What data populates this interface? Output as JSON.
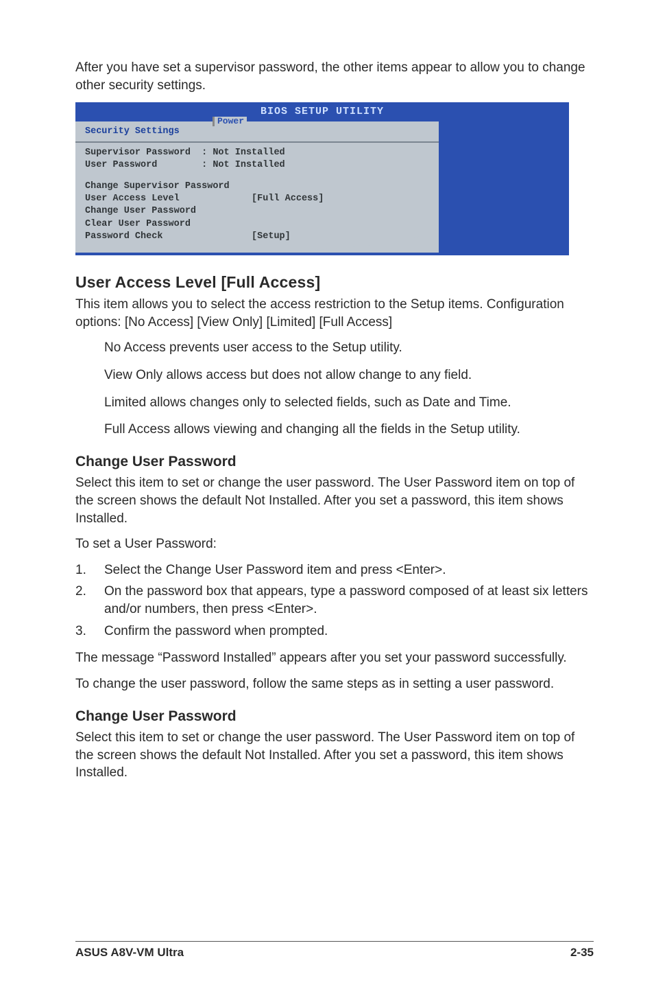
{
  "intro": "After you have set a supervisor password, the other items appear to allow you to change other security settings.",
  "bios": {
    "title": "BIOS SETUP UTILITY",
    "tab": "Power",
    "section_title": "Security Settings",
    "lines": {
      "l1": "Supervisor Password  : Not Installed",
      "l2": "User Password        : Not Installed",
      "l3": "Change Supervisor Password",
      "l4": "User Access Level             [Full Access]",
      "l5": "Change User Password",
      "l6": "Clear User Password",
      "l7": "Password Check                [Setup]"
    }
  },
  "ual": {
    "heading": "User Access Level [Full Access]",
    "p1": "This item allows you to select the access restriction to the Setup items. Configuration options: [No Access] [View Only] [Limited] [Full Access]",
    "b1": "No Access prevents user access to the Setup utility.",
    "b2": "View Only allows access but does not allow change to any field.",
    "b3": "Limited allows changes only to selected fields, such as Date and Time.",
    "b4": "Full Access allows viewing and changing all the fields in the Setup utility."
  },
  "cup1": {
    "heading": "Change User Password",
    "p1": "Select this item to set or change the user password. The User Password item on top of the screen shows the default Not Installed. After you set a password, this item shows Installed.",
    "p2": "To set a User Password:",
    "s1": "Select the Change User Password item and press <Enter>.",
    "s2": "On the password box that appears, type a password composed of at least six letters and/or numbers, then press <Enter>.",
    "s3": "Confirm the password when prompted.",
    "p3": "The message “Password Installed” appears after you set your password successfully.",
    "p4": "To change the user password, follow the same steps as in setting a user password."
  },
  "cup2": {
    "heading": "Change User Password",
    "p1": "Select this item to set or change the user password. The User Password item on top of the screen shows the default Not Installed. After you set a password, this item shows Installed."
  },
  "steps_num": {
    "n1": "1.",
    "n2": "2.",
    "n3": "3."
  },
  "footer": {
    "left": "ASUS A8V-VM Ultra",
    "right": "2-35"
  }
}
